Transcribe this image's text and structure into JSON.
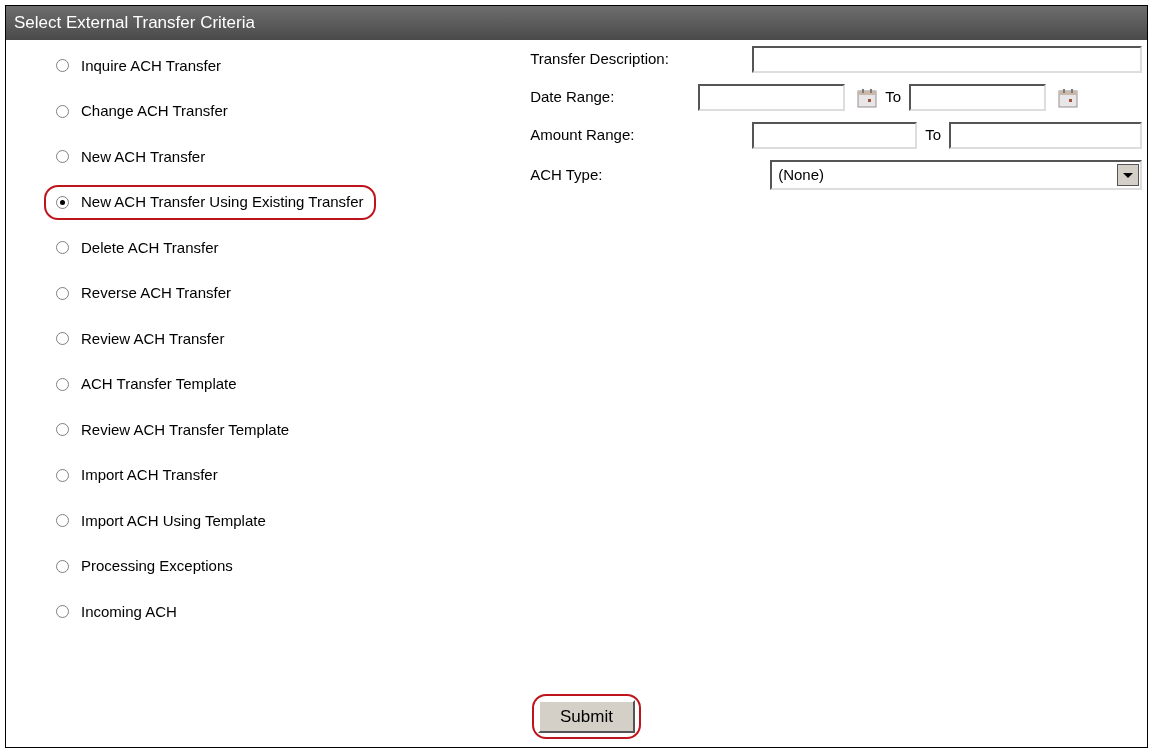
{
  "panel": {
    "title": "Select External Transfer Criteria"
  },
  "options": [
    {
      "label": "Inquire ACH Transfer",
      "selected": false,
      "highlighted": false
    },
    {
      "label": "Change ACH Transfer",
      "selected": false,
      "highlighted": false
    },
    {
      "label": "New ACH Transfer",
      "selected": false,
      "highlighted": false
    },
    {
      "label": "New ACH Transfer Using Existing Transfer",
      "selected": true,
      "highlighted": true
    },
    {
      "label": "Delete ACH Transfer",
      "selected": false,
      "highlighted": false
    },
    {
      "label": "Reverse ACH Transfer",
      "selected": false,
      "highlighted": false
    },
    {
      "label": "Review ACH Transfer",
      "selected": false,
      "highlighted": false
    },
    {
      "label": "ACH Transfer Template",
      "selected": false,
      "highlighted": false
    },
    {
      "label": "Review ACH Transfer Template",
      "selected": false,
      "highlighted": false
    },
    {
      "label": "Import ACH Transfer",
      "selected": false,
      "highlighted": false
    },
    {
      "label": "Import ACH Using Template",
      "selected": false,
      "highlighted": false
    },
    {
      "label": "Processing Exceptions",
      "selected": false,
      "highlighted": false
    },
    {
      "label": "Incoming ACH",
      "selected": false,
      "highlighted": false
    }
  ],
  "criteria": {
    "description_label": "Transfer Description:",
    "date_label": "Date Range:",
    "date_to": "To",
    "amount_label": "Amount Range:",
    "amount_to": "To",
    "type_label": "ACH Type:",
    "type_value": "(None)"
  },
  "submit": {
    "label": "Submit",
    "highlighted": true
  }
}
